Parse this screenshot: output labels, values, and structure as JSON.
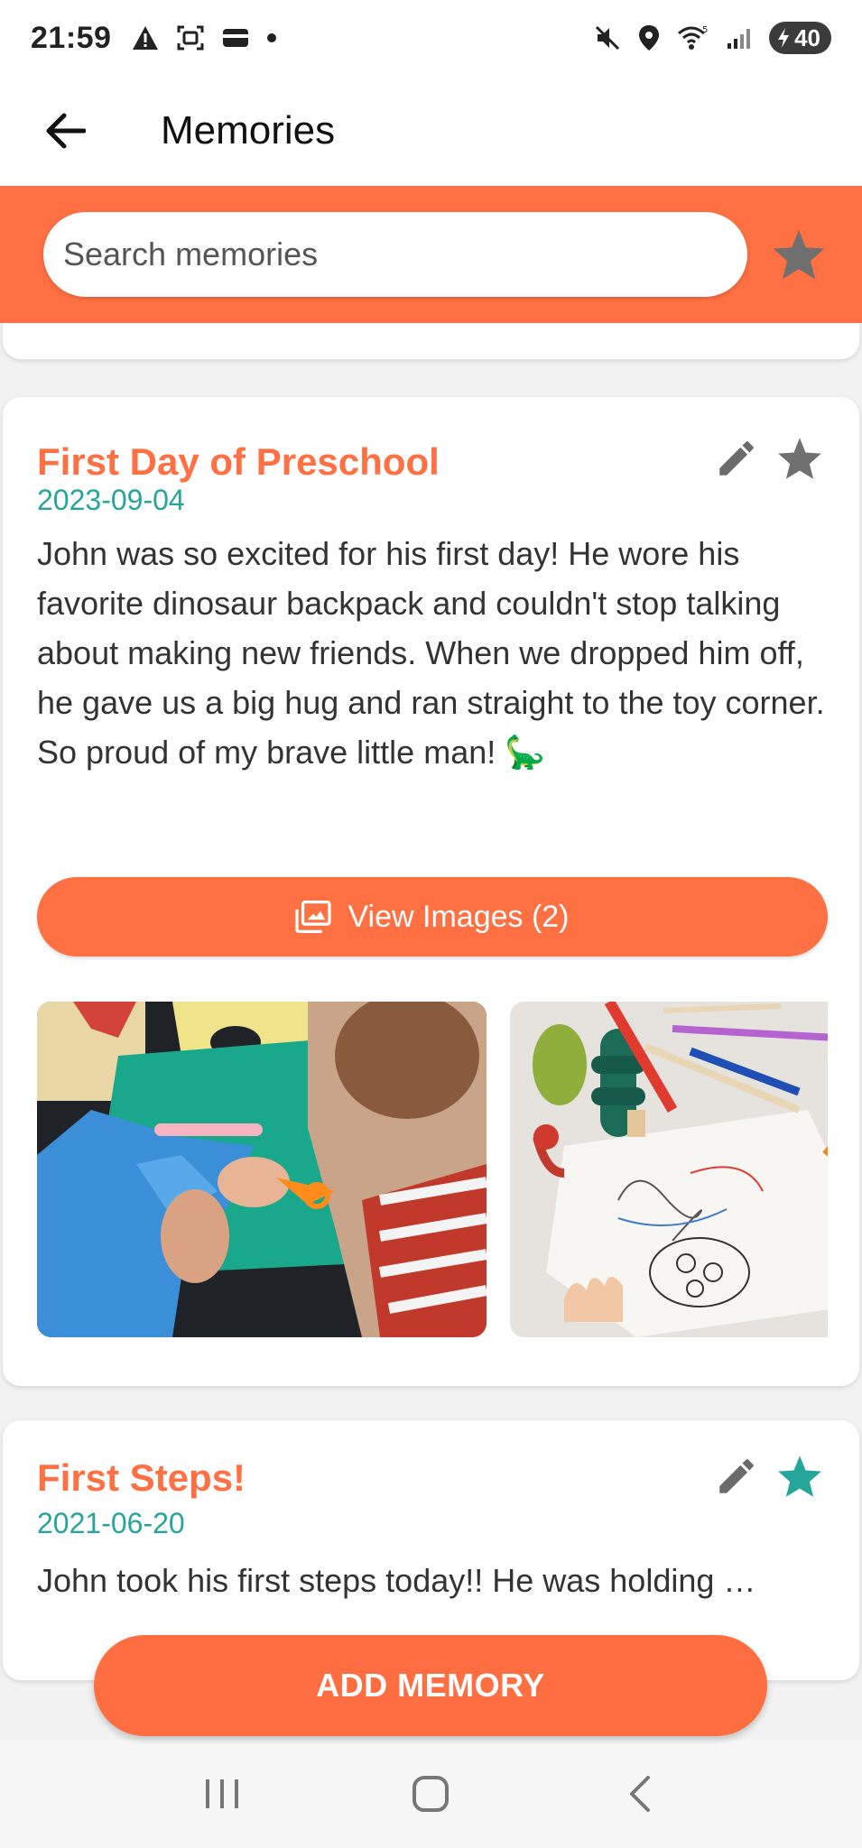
{
  "status_bar": {
    "time": "21:59",
    "battery": "40"
  },
  "app_bar": {
    "title": "Memories"
  },
  "search": {
    "placeholder": "Search memories"
  },
  "memories": [
    {
      "title": "First Day of Preschool",
      "date": "2023-09-04",
      "text": "John was so excited for his first day! He wore his favorite dinosaur backpack and couldn't stop talking about making new friends. When we dropped him off, he gave us a big hug and ran straight to the toy corner. So proud of my brave little man! 🦕",
      "view_images_label": "View Images (2)",
      "favorite": false
    },
    {
      "title": "First Steps!",
      "date": "2021-06-20",
      "text": "John took his first steps today!! He was holding …",
      "favorite": true
    }
  ],
  "fab": {
    "label": "ADD MEMORY"
  },
  "colors": {
    "accent": "#ff7043",
    "date": "#26a69a",
    "favorite_on": "#26a69a",
    "favorite_off": "#707070"
  }
}
